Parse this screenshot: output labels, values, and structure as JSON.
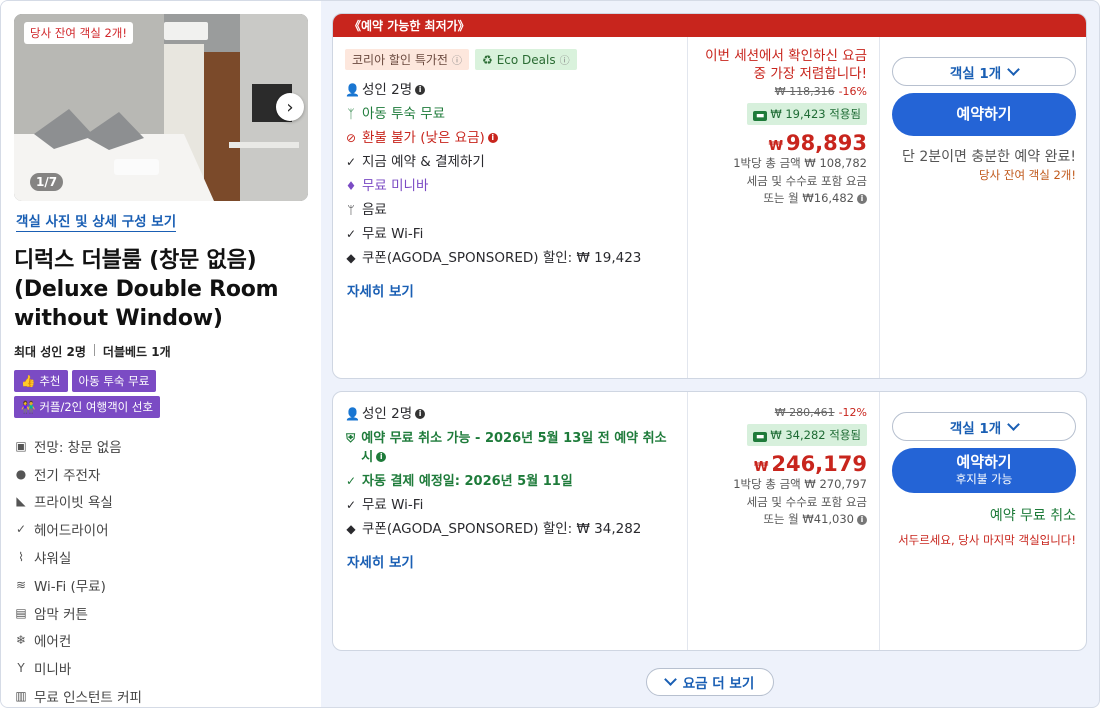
{
  "room": {
    "photo_badge": "당사 잔여 객실 2개!",
    "photo_counter": "1/7",
    "photo_link": "객실 사진 및 상세 구성 보기",
    "title": "디럭스 더블룸 (창문 없음) (Deluxe Double Room without Window)",
    "max_guests": "최대 성인 2명",
    "bed": "더블베드 1개",
    "tags": [
      {
        "label": "추천",
        "icon": "thumbs-up-icon"
      },
      {
        "label": "아동 투숙 무료",
        "icon": ""
      },
      {
        "label": "커플/2인 여행객이 선호",
        "icon": "couple-icon"
      }
    ],
    "amenities": [
      {
        "label": "전망: 창문 없음",
        "icon": "view-icon"
      },
      {
        "label": "전기 주전자",
        "icon": "kettle-icon"
      },
      {
        "label": "프라이빗 욕실",
        "icon": "bathtub-icon"
      },
      {
        "label": "헤어드라이어",
        "icon": "check-icon"
      },
      {
        "label": "샤워실",
        "icon": "shower-icon"
      },
      {
        "label": "Wi-Fi (무료)",
        "icon": "wifi-icon"
      },
      {
        "label": "암막 커튼",
        "icon": "curtain-icon"
      },
      {
        "label": "에어컨",
        "icon": "snowflake-icon"
      },
      {
        "label": "미니바",
        "icon": "cocktail-icon"
      },
      {
        "label": "무료 인스턴트 커피",
        "icon": "coffee-icon"
      }
    ]
  },
  "offer1": {
    "banner": "《예약 가능한 최저가》",
    "promo_korea": "코리아 할인 특가전",
    "promo_eco": "Eco Deals",
    "features": {
      "adults": "성인 2명",
      "kids": "아동 투숙 무료",
      "refund": "환불 불가 (낮은 요금)",
      "pay": "지금 예약 & 결제하기",
      "minibar": "무료 미니바",
      "drinks": "음료",
      "wifi": "무료 Wi-Fi",
      "coupon": "쿠폰(AGODA_SPONSORED) 할인: ₩ 19,423"
    },
    "details_link": "자세히 보기",
    "cheapest_note": "이번 세션에서 확인하신 요금 중 가장 저렴합니다!",
    "original_price": "₩ 118,316",
    "discount_pct": "-16%",
    "coupon_applied": "₩ 19,423 적용됨",
    "price_symbol": "₩",
    "price": "98,893",
    "per_night_total": "1박당 총 금액 ₩ 108,782",
    "tax_note": "세금 및 수수료 포함 요금",
    "monthly": "또는 월 ₩16,482",
    "rooms_select": "객실 1개",
    "book_label": "예약하기",
    "hint": "단 2분이면 충분한 예약 완료!",
    "hint_scarcity": "당사 잔여 객실 2개!"
  },
  "offer2": {
    "features": {
      "adults": "성인 2명",
      "free_cancel": "예약 무료 취소 가능 - 2026년 5월 13일 전 예약 취소 시",
      "autopay": "자동 결제 예정일: 2026년 5월 11일",
      "wifi": "무료 Wi-Fi",
      "coupon": "쿠폰(AGODA_SPONSORED) 할인: ₩ 34,282"
    },
    "details_link": "자세히 보기",
    "original_price": "₩ 280,461",
    "discount_pct": "-12%",
    "coupon_applied": "₩ 34,282 적용됨",
    "price_symbol": "₩",
    "price": "246,179",
    "per_night_total": "1박당 총 금액 ₩ 270,797",
    "tax_note": "세금 및 수수료 포함 요금",
    "monthly": "또는 월 ₩41,030",
    "rooms_select": "객실 1개",
    "book_label": "예약하기",
    "book_sub": "후지불 가능",
    "free_cancel_note": "예약 무료 취소",
    "hint_scarcity": "서두르세요, 당사 마지막 객실입니다!"
  },
  "show_more": "요금 더 보기",
  "colors": {
    "accent_blue": "#2464d6",
    "price_red": "#c8251d",
    "green": "#1e7b3a",
    "purple_tag": "#7b4bc4"
  }
}
